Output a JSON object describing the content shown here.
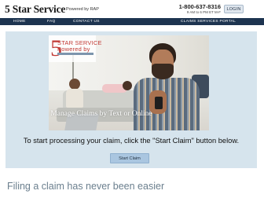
{
  "header": {
    "brand": "5 Star Service",
    "powered_by": "Powered by RAP",
    "phone": "1-800-637-8316",
    "hours": "9 AM to 6 PM ET M-F",
    "login_label": "LOGIN"
  },
  "nav": {
    "items": [
      {
        "label": "HOME"
      },
      {
        "label": "FAQ"
      },
      {
        "label": "CONTACT US"
      }
    ],
    "portal_label": "CLAIMS SERVICES PORTAL"
  },
  "hero": {
    "logo_line1": "STAR SERVICE",
    "logo_line2": "Powered by",
    "caption": "e & Manage Claims by Text or Online"
  },
  "main": {
    "instruction": "To start processing your claim, click the \"Start Claim\" button below.",
    "start_button": "Start Claim",
    "tagline": "Filing a claim has never been easier"
  },
  "colors": {
    "nav_bg": "#1d3450",
    "panel_bg": "#d6e4ed",
    "button_bg": "#aac6e0",
    "logo_red": "#c23a35",
    "tagline": "#6b7f8e"
  }
}
